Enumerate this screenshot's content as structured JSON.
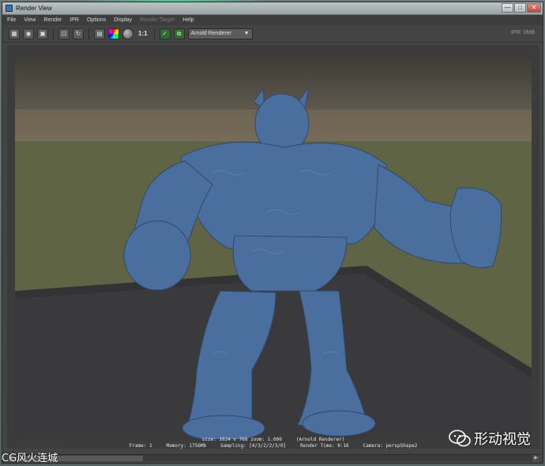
{
  "window": {
    "title": "Render View",
    "controls": [
      "—",
      "□",
      "✕"
    ]
  },
  "menu": [
    {
      "label": "File",
      "disabled": false
    },
    {
      "label": "View",
      "disabled": false
    },
    {
      "label": "Render",
      "disabled": false
    },
    {
      "label": "IPR",
      "disabled": false
    },
    {
      "label": "Options",
      "disabled": false
    },
    {
      "label": "Display",
      "disabled": false
    },
    {
      "label": "Render Target",
      "disabled": true
    },
    {
      "label": "Help",
      "disabled": false
    }
  ],
  "toolbar": {
    "icons": [
      "render-icon",
      "ipr-render-icon",
      "snapshot-icon",
      "region-icon",
      "refresh-icon",
      "rgb-channels-icon",
      "sphere-icon"
    ],
    "ratio_label": "1:1",
    "renderer": "Arnold Renderer",
    "ipr_status": "IPR: 0MB"
  },
  "status": {
    "line1": "size: 1024 x 768 zoom: 1.000     (Arnold Renderer)",
    "frame": "Frame: 1",
    "memory": "Memory: 1756Mb",
    "sampling": "Sampling: [4/3/2/2/3/0]",
    "render_time": "Render Time: 0:16",
    "camera": "Camera: perspShape2"
  },
  "watermarks": {
    "left": "CG风火连城",
    "right": "形动视觉"
  },
  "colors": {
    "creature": "#4a6f9e",
    "floor": "#3a3a3c",
    "grass": "#5f6444"
  }
}
